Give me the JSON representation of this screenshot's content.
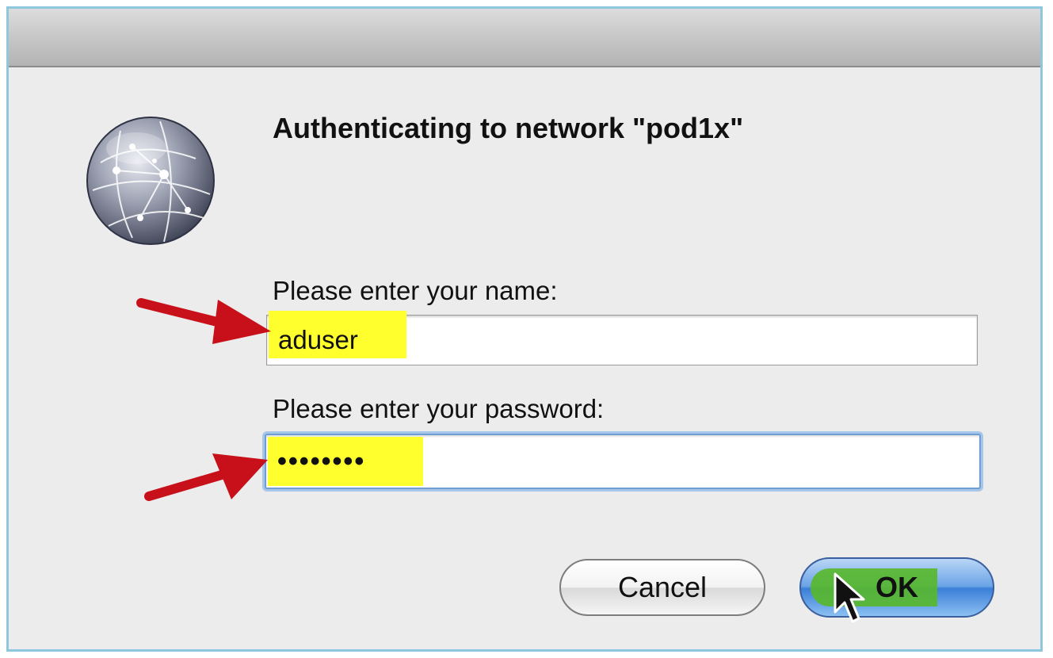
{
  "dialog": {
    "heading": "Authenticating to network \"pod1x\"",
    "name_label": "Please enter your name:",
    "name_value": "aduser",
    "password_label": "Please enter your password:",
    "password_value": "••••••••",
    "cancel_label": "Cancel",
    "ok_label": "OK"
  },
  "icons": {
    "app_icon": "network-globe-icon",
    "annotation": "red-arrow",
    "pointer": "mouse-cursor-icon"
  },
  "colors": {
    "highlight": "#ffff2e",
    "arrow": "#c8101a",
    "ok_button": "#3a7ed8",
    "focus_ring": "#a7c7ea"
  }
}
